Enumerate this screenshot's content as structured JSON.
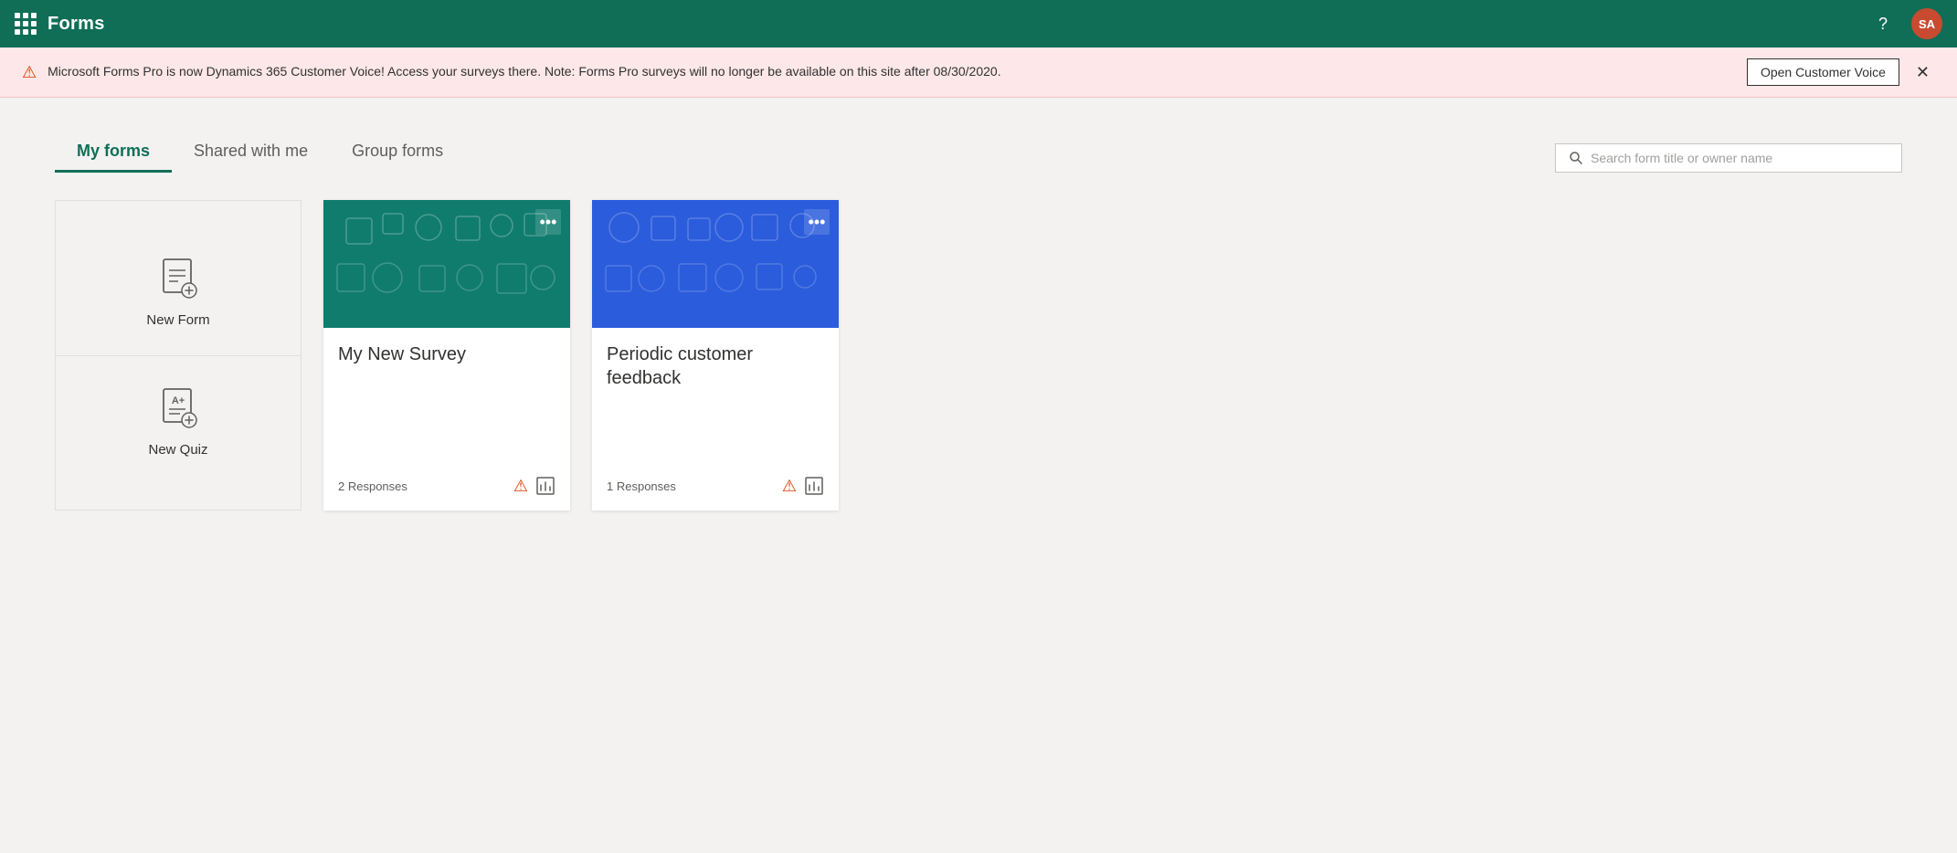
{
  "app": {
    "title": "Forms"
  },
  "user": {
    "initials": "SA"
  },
  "banner": {
    "message": "Microsoft Forms Pro is now Dynamics 365 Customer Voice! Access your surveys there. Note: Forms Pro surveys will no longer be available on this site after 08/30/2020.",
    "action_label": "Open Customer Voice"
  },
  "tabs": {
    "my_forms": "My forms",
    "shared_with_me": "Shared with me",
    "group_forms": "Group forms"
  },
  "search": {
    "placeholder": "Search form title or owner name"
  },
  "new_card": {
    "new_form_label": "New Form",
    "new_quiz_label": "New Quiz"
  },
  "forms": [
    {
      "id": "1",
      "title": "My New Survey",
      "responses": "2 Responses",
      "header_color": "teal",
      "more_label": "•••"
    },
    {
      "id": "2",
      "title": "Periodic customer feedback",
      "responses": "1 Responses",
      "header_color": "blue",
      "more_label": "•••"
    }
  ]
}
